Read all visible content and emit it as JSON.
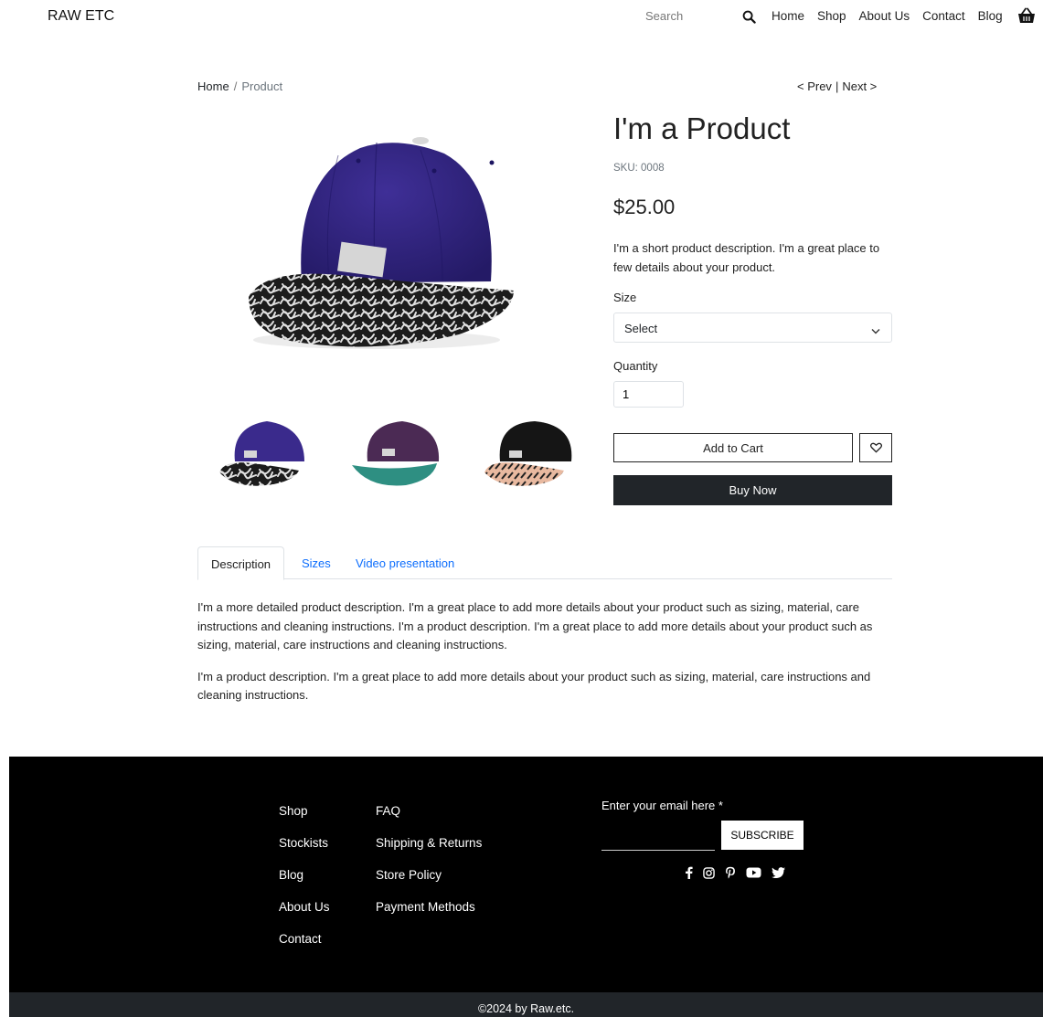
{
  "header": {
    "brand": "RAW ETC",
    "search_placeholder": "Search",
    "nav": [
      "Home",
      "Shop",
      "About Us",
      "Contact",
      "Blog"
    ]
  },
  "breadcrumb": {
    "home": "Home",
    "separator": "/",
    "current": "Product"
  },
  "pager": {
    "prev": "< Prev",
    "separator": "|",
    "next": "Next >"
  },
  "product": {
    "title": "I'm a Product",
    "sku": "SKU: 0008",
    "price": "$25.00",
    "short_description": "I'm a short product description. I'm a great place to few details about your product.",
    "size_label": "Size",
    "size_selected": "Select",
    "quantity_label": "Quantity",
    "quantity_value": "1",
    "add_to_cart": "Add to Cart",
    "buy_now": "Buy Now",
    "image_colors": {
      "crown_blue": "#3a2a8c",
      "crown_purple": "#4b2a54",
      "brim_teal": "#2e8f82",
      "crown_black": "#151515",
      "brim_peach": "#e8b9a0"
    }
  },
  "tabs": {
    "items": [
      "Description",
      "Sizes",
      "Video presentation"
    ],
    "active": "Description",
    "content": [
      "I'm a more detailed product description. I'm a great place to add more details about your product such as sizing, material, care instructions and cleaning instructions. I'm a product description. I'm a great place to add more details about your product such as sizing, material, care instructions and cleaning instructions.",
      "I'm a product description. I'm a great place to add more details about your product such as sizing, material, care instructions and cleaning instructions."
    ]
  },
  "footer": {
    "col1": [
      "Shop",
      "Stockists",
      "Blog",
      "About Us",
      "Contact"
    ],
    "col2": [
      "FAQ",
      "Shipping & Returns",
      "Store Policy",
      "Payment Methods"
    ],
    "email_label": "Enter your email here *",
    "subscribe": "SUBSCRIBE",
    "socials": [
      "facebook-icon",
      "instagram-icon",
      "pinterest-icon",
      "youtube-icon",
      "twitter-icon"
    ],
    "copyright": "©2024 by Raw.etc."
  }
}
